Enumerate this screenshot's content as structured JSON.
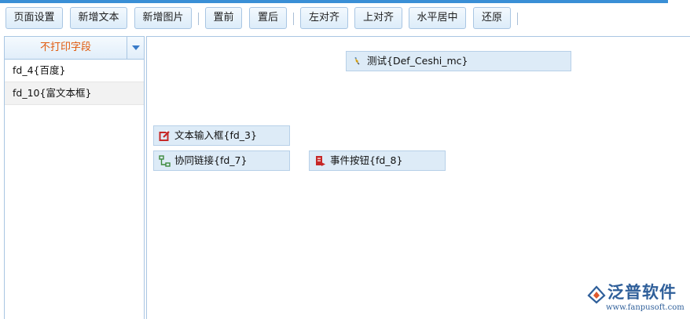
{
  "toolbar": {
    "buttons": [
      "页面设置",
      "新增文本",
      "新增图片",
      "置前",
      "置后",
      "左对齐",
      "上对齐",
      "水平居中",
      "还原"
    ]
  },
  "left_panel": {
    "title": "不打印字段",
    "fields": [
      "fd_4{百度}",
      "fd_10{富文本框}"
    ]
  },
  "canvas": {
    "elements": [
      {
        "label": "测试{Def_Ceshi_mc}",
        "icon": "pencil-icon"
      },
      {
        "label": "文本输入框{fd_3}",
        "icon": "edit-box-icon"
      },
      {
        "label": "协同链接{fd_7}",
        "icon": "flow-link-icon"
      },
      {
        "label": "事件按钮{fd_8}",
        "icon": "event-button-icon"
      }
    ]
  },
  "logo": {
    "brand": "泛普软件",
    "url": "www.fanpusoft.com"
  },
  "colors": {
    "accent": "#3a8fd6",
    "panel_title": "#e05a0c",
    "element_bg": "#ddebf7",
    "button_border": "#a9c6e3"
  }
}
